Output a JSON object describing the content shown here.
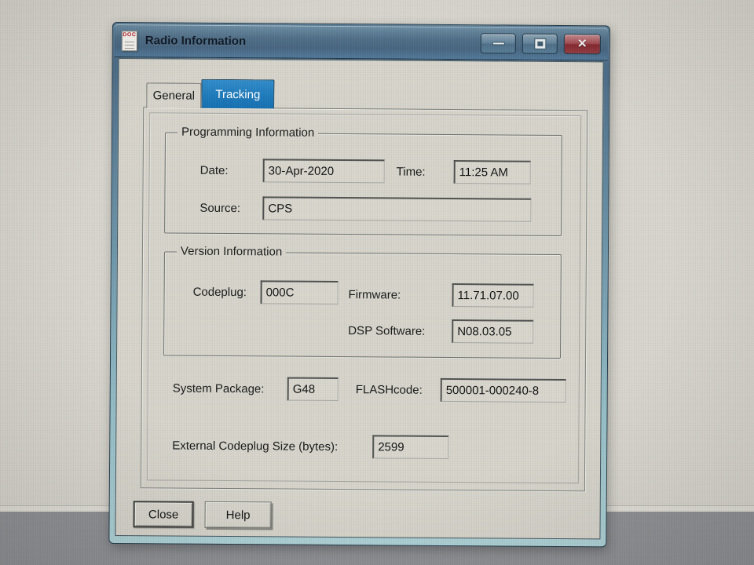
{
  "window": {
    "title": "Radio Information",
    "icon_text": "DOC",
    "controls": {
      "close_glyph": "✕"
    }
  },
  "tabs": [
    {
      "label": "General",
      "active": false
    },
    {
      "label": "Tracking",
      "active": true
    }
  ],
  "programming_information": {
    "legend": "Programming Information",
    "date_label": "Date:",
    "date_value": "30-Apr-2020",
    "time_label": "Time:",
    "time_value": "11:25 AM",
    "source_label": "Source:",
    "source_value": "CPS"
  },
  "version_information": {
    "legend": "Version Information",
    "codeplug_label": "Codeplug:",
    "codeplug_value": "000C",
    "firmware_label": "Firmware:",
    "firmware_value": "11.71.07.00",
    "dsp_label": "DSP Software:",
    "dsp_value": "N08.03.05"
  },
  "system": {
    "system_package_label": "System Package:",
    "system_package_value": "G48",
    "flashcode_label": "FLASHcode:",
    "flashcode_value": "500001-000240-8",
    "external_size_label": "External Codeplug Size (bytes):",
    "external_size_value": "2599"
  },
  "buttons": {
    "close": "Close",
    "help": "Help"
  },
  "colors": {
    "titlebar_blue": "#4e6d86",
    "active_tab_blue": "#1a78ba",
    "close_button_red": "#85262d",
    "dialog_face": "#d6d4cb",
    "desk_lower_gray": "#8e9094"
  }
}
